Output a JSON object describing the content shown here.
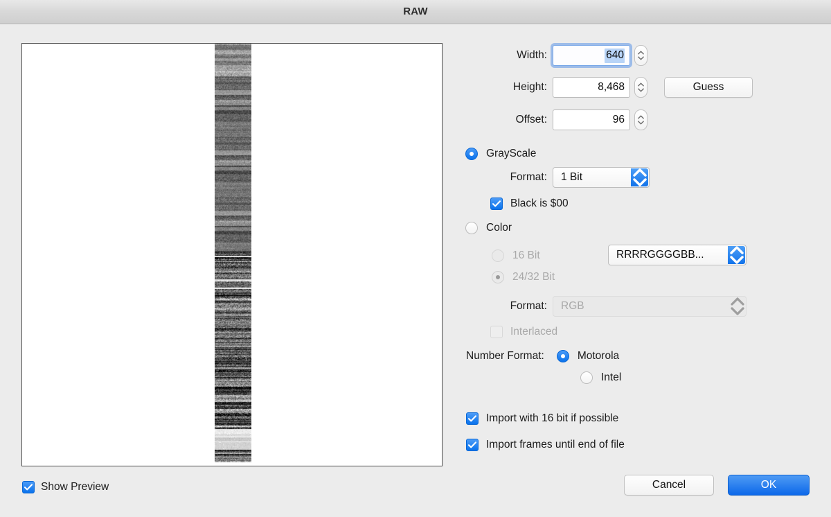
{
  "window": {
    "title": "RAW"
  },
  "preview": {
    "show_preview_label": "Show Preview",
    "show_preview_checked": true
  },
  "dimensions": {
    "width_label": "Width:",
    "width_value": "640",
    "height_label": "Height:",
    "height_value": "8,468",
    "offset_label": "Offset:",
    "offset_value": "96",
    "guess_label": "Guess"
  },
  "grayscale": {
    "label": "GrayScale",
    "selected": true,
    "format_label": "Format:",
    "format_value": "1 Bit",
    "black_is_label": "Black is $00",
    "black_is_checked": true
  },
  "color": {
    "label": "Color",
    "selected": false,
    "bit16_label": "16 Bit",
    "bit2432_label": "24/32 Bit",
    "channel_order_value": "RRRRGGGGBB...",
    "format_label": "Format:",
    "format_value": "RGB",
    "interlaced_label": "Interlaced",
    "interlaced_checked": false
  },
  "number_format": {
    "label": "Number Format:",
    "motorola_label": "Motorola",
    "intel_label": "Intel",
    "selected": "Motorola"
  },
  "import_options": {
    "sixteen_bit_label": "Import with 16 bit if possible",
    "sixteen_bit_checked": true,
    "frames_label": "Import frames until end of file",
    "frames_checked": true
  },
  "actions": {
    "cancel_label": "Cancel",
    "ok_label": "OK"
  },
  "colors": {
    "accent": "#0a72ec",
    "window_bg": "#ececec",
    "selection": "#b8d4f7"
  }
}
